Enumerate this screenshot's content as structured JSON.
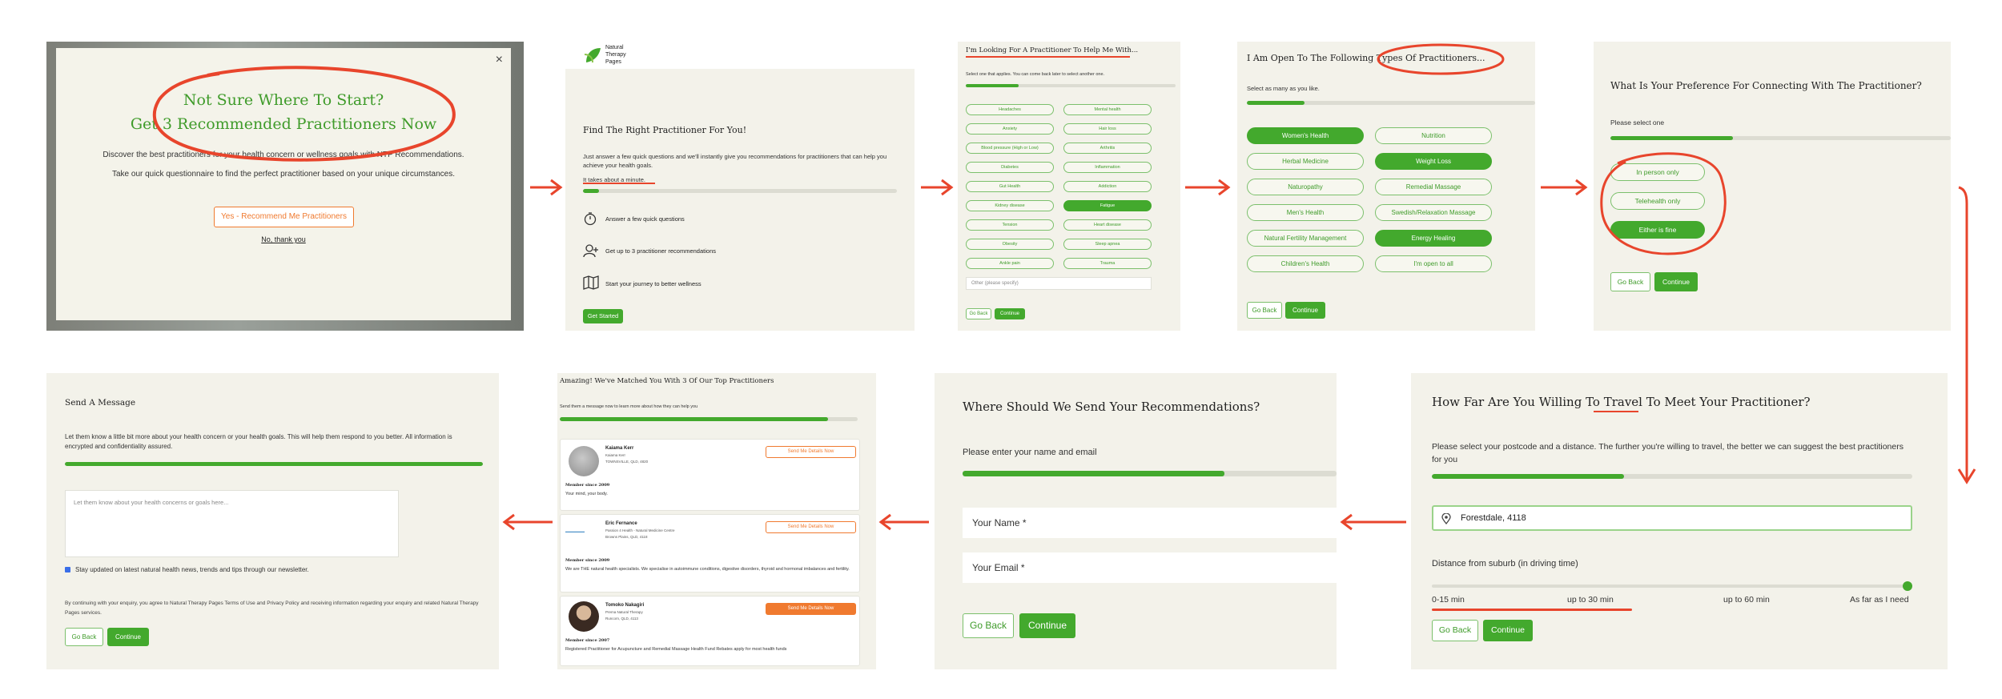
{
  "colors": {
    "brand_green": "#43a92d",
    "accent_red": "#e8452c",
    "panel_bg": "#f3f2ea",
    "orange": "#f07a2f"
  },
  "s1": {
    "title_line1": "Not Sure Where To Start?",
    "title_line2": "Get 3 Recommended Practitioners Now",
    "body1": "Discover the best practitioners for your health concern or wellness goals with NTP Recommendations.",
    "body2": "Take our quick questionnaire to find the perfect practitioner based on your unique circumstances.",
    "cta": "Yes - Recommend Me Practitioners",
    "decline": "No, thank you",
    "close": "×"
  },
  "s2": {
    "logo_line1": "Natural",
    "logo_line2": "Therapy",
    "logo_line3": "Pages",
    "title": "Find The Right Practitioner For You!",
    "body": "Just answer a few quick questions and we'll instantly give you recommendations for practitioners that can help you achieve your health goals.",
    "time": "It takes about a minute.",
    "progress": 0.05,
    "features": [
      "Answer a few quick questions",
      "Get up to 3 practitioner recommendations",
      "Start your journey to better wellness"
    ],
    "cta": "Get Started"
  },
  "s3": {
    "title": "I'm Looking For A Practitioner To Help Me With...",
    "hint": "Select one that applies. You can come back later to select another one.",
    "progress": 0.25,
    "options": [
      "Headaches",
      "Mental health",
      "Anxiety",
      "Hair loss",
      "Blood pressure (High or Low)",
      "Arthritis",
      "Diabetes",
      "Inflammation",
      "Gut Health",
      "Addiction",
      "Kidney disease",
      "Fatigue",
      "Tension",
      "Heart disease",
      "Obesity",
      "Sleep apnea",
      "Ankle pain",
      "Trauma"
    ],
    "selected": "Fatigue",
    "other_placeholder": "Other (please specify)",
    "back": "Go Back",
    "continue": "Continue"
  },
  "s4": {
    "title": "I Am Open To The Following Types Of Practitioners...",
    "hint": "Select as many as you like.",
    "progress": 0.2,
    "options": [
      "Women's Health",
      "Nutrition",
      "Herbal Medicine",
      "Weight Loss",
      "Naturopathy",
      "Remedial Massage",
      "Men's Health",
      "Swedish/Relaxation Massage",
      "Natural Fertility Management",
      "Energy Healing",
      "Children's Health",
      "I'm open to all"
    ],
    "selected": [
      "Women's Health",
      "Weight Loss",
      "Energy Healing"
    ],
    "back": "Go Back",
    "continue": "Continue"
  },
  "s5": {
    "title": "What Is Your Preference For Connecting With The Practitioner?",
    "hint": "Please select one",
    "progress": 0.36,
    "options": [
      "In person only",
      "Telehealth only",
      "Either is fine"
    ],
    "selected": "Either is fine",
    "back": "Go Back",
    "continue": "Continue"
  },
  "s6": {
    "title": "How Far Are You Willing To Travel To Meet Your Practitioner?",
    "body": "Please select your postcode and a distance. The further you're willing to travel, the better we can suggest the best practitioners for you",
    "progress": 0.4,
    "location": "Forestdale, 4118",
    "distance_label": "Distance from suburb (in driving time)",
    "ticks": [
      "0-15 min",
      "up to 30 min",
      "up to 60 min",
      "As far as I need"
    ],
    "slider_value": 1.0,
    "back": "Go Back",
    "continue": "Continue"
  },
  "s7": {
    "title": "Where Should We Send Your Recommendations?",
    "hint": "Please enter your name and email",
    "progress": 0.7,
    "name_placeholder": "Your Name *",
    "email_placeholder": "Your Email *",
    "back": "Go Back",
    "continue": "Continue"
  },
  "s8": {
    "title": "Amazing! We've Matched You With 3 Of Our Top Practitioners",
    "hint": "Send them a message now to learn more about how they can help you",
    "progress": 0.9,
    "practitioners": [
      {
        "name": "Kaiama Kerr",
        "sub": "Kaiama Kerr",
        "loc": "TOWNSVILLE, QLD, 4820",
        "since": "Member since 2009",
        "desc": "Your mind, your body.",
        "button": "Send Me Details Now"
      },
      {
        "name": "Eric Fernance",
        "sub": "Passion 4 Health - Natural Medicine Centre",
        "loc": "Browns Plains, QLD, 4118",
        "since": "Member since 2009",
        "desc": "We are THE natural health specialists. We specialise in autoimmune conditions, digestive disorders, thyroid and hormonal imbalances and fertility.",
        "button": "Send Me Details Now"
      },
      {
        "name": "Tomoko Nakagiri",
        "sub": "Prema Natural Therapy",
        "loc": "Runcorn, QLD, 4113",
        "since": "Member since 2007",
        "desc": "Registered Practitioner for Acupuncture and Remedial Massage Health Fund Rebates apply for most health funds",
        "button": "Send Me Details Now"
      }
    ]
  },
  "s9": {
    "title": "Send A Message",
    "body": "Let them know a little bit more about your health concern or your health goals. This will help them respond to you better. All information is encrypted and confidentiality assured.",
    "progress": 1.0,
    "placeholder": "Let them know about your health concerns or goals here...",
    "checkbox": "Stay updated on latest natural health news, trends and tips through our newsletter.",
    "legal": "By continuing with your enquiry, you agree to Natural Therapy Pages Terms of Use and Privacy Policy and receiving information regarding your enquiry and related Natural Therapy Pages services.",
    "back": "Go Back",
    "continue": "Continue"
  }
}
